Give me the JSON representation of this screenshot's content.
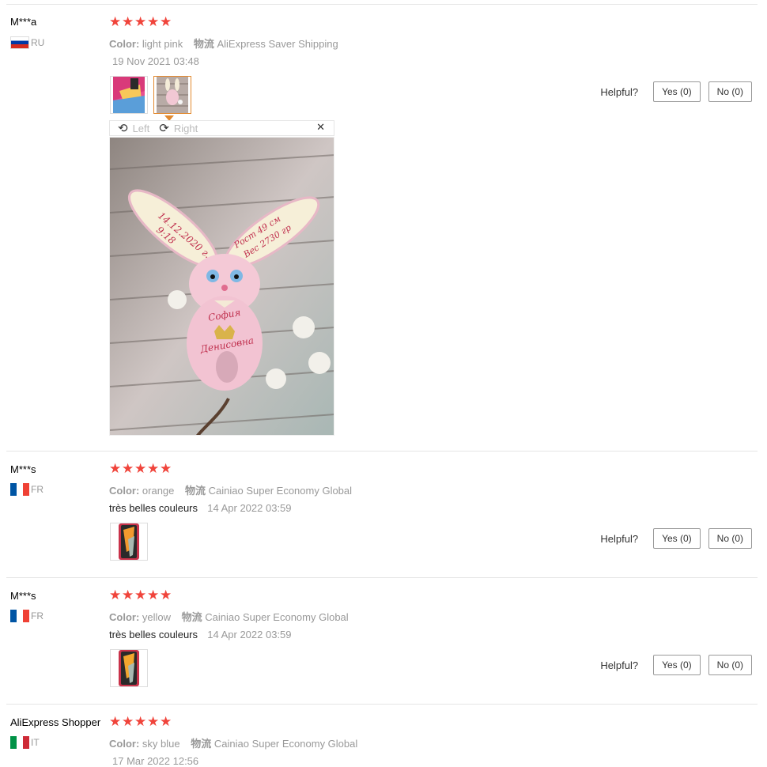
{
  "reviews": [
    {
      "user": "M***a",
      "country": "RU",
      "color_label": "Color:",
      "color_value": "light pink",
      "ship_label": "物流",
      "ship_value": "AliExpress Saver Shipping",
      "text": "",
      "date": "19 Nov 2021 03:48",
      "helpful_label": "Helpful?",
      "yes_label": "Yes (0)",
      "no_label": "No (0)",
      "viewer": {
        "left_label": "Left",
        "right_label": "Right",
        "close_icon": "close-icon",
        "photo_text": [
          "14.12.2020 г.",
          "9:18",
          "Рост 49 см",
          "Вес 2730 гр",
          "София",
          "Денисовна"
        ]
      }
    },
    {
      "user": "M***s",
      "country": "FR",
      "color_label": "Color:",
      "color_value": "orange",
      "ship_label": "物流",
      "ship_value": "Cainiao Super Economy Global",
      "text": "très belles couleurs",
      "date": "14 Apr 2022 03:59",
      "helpful_label": "Helpful?",
      "yes_label": "Yes (0)",
      "no_label": "No (0)"
    },
    {
      "user": "M***s",
      "country": "FR",
      "color_label": "Color:",
      "color_value": "yellow",
      "ship_label": "物流",
      "ship_value": "Cainiao Super Economy Global",
      "text": "très belles couleurs",
      "date": "14 Apr 2022 03:59",
      "helpful_label": "Helpful?",
      "yes_label": "Yes (0)",
      "no_label": "No (0)"
    },
    {
      "user": "AliExpress Shopper",
      "country": "IT",
      "color_label": "Color:",
      "color_value": "sky blue",
      "ship_label": "物流",
      "ship_value": "Cainiao Super Economy Global",
      "date": "17 Mar 2022 12:56"
    }
  ],
  "rating": 5,
  "colors": {
    "star": "#f0443b",
    "active_thumb": "#e2892f"
  }
}
